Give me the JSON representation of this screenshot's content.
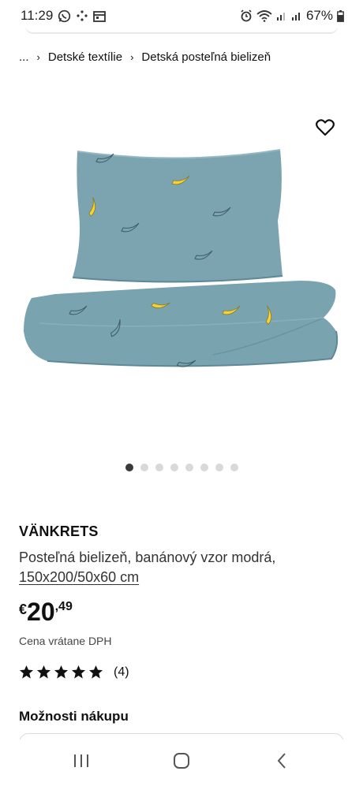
{
  "status_bar": {
    "time": "11:29",
    "battery": "67%"
  },
  "breadcrumb": {
    "items": [
      "...",
      "Detské textílie",
      "Detská posteľná bielizeň"
    ]
  },
  "product": {
    "name": "VÄNKRETS",
    "description": "Posteľná bielizeň, banánový vzor modrá,",
    "size": "150x200/50x60 cm",
    "price": {
      "currency": "€",
      "integer": "20",
      "decimal": ",49"
    },
    "vat_note": "Cena vrátane DPH",
    "rating": {
      "stars": 5,
      "count": "(4)"
    }
  },
  "gallery": {
    "total_images": 8,
    "active_index": 0
  },
  "purchase_options": {
    "title": "Možnosti nákupu"
  },
  "colors": {
    "fabric": "#7ba3b0",
    "banana": "#f2d33a",
    "dot_active": "#3a3a3a",
    "dot_inactive": "#d9d9d9"
  },
  "icons": [
    "whatsapp-icon",
    "alarm-icon",
    "wifi-icon",
    "signal-icon",
    "battery-icon",
    "heart-icon",
    "star-icon",
    "recents-icon",
    "home-icon",
    "back-icon"
  ]
}
